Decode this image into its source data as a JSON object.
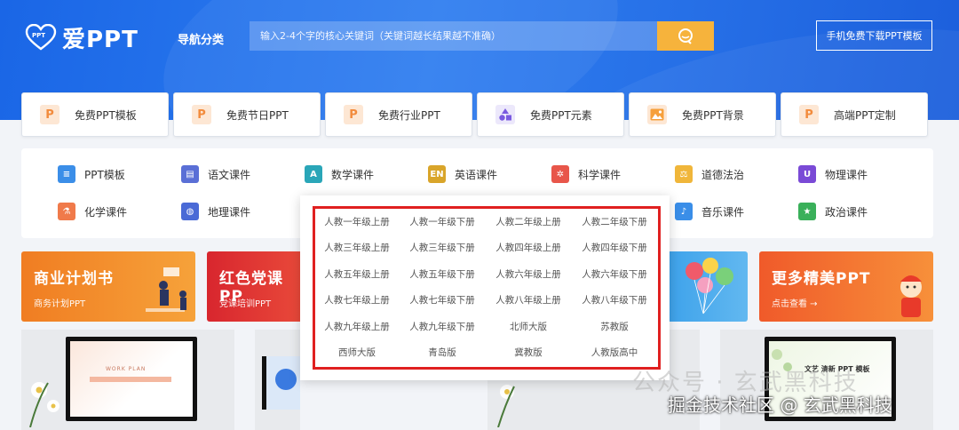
{
  "header": {
    "logo_text": "爱PPT",
    "logo_small": "PPT",
    "nav_category": "导航分类",
    "search_placeholder": "输入2-4个字的核心关键词（关键词越长结果越不准确）",
    "mobile_button": "手机免费下载PPT模板"
  },
  "categories": [
    {
      "label": "免费PPT模板",
      "icon": "P"
    },
    {
      "label": "免费节日PPT",
      "icon": "P"
    },
    {
      "label": "免费行业PPT",
      "icon": "P"
    },
    {
      "label": "免费PPT元素",
      "icon": "shapes"
    },
    {
      "label": "免费PPT背景",
      "icon": "image"
    },
    {
      "label": "高端PPT定制",
      "icon": "P"
    }
  ],
  "subjects": [
    {
      "label": "PPT模板",
      "color": "#3b8ee8"
    },
    {
      "label": "语文课件",
      "color": "#5a6fd6"
    },
    {
      "label": "数学课件",
      "color": "#2aa6b8"
    },
    {
      "label": "英语课件",
      "color": "#d9a52a"
    },
    {
      "label": "科学课件",
      "color": "#e8564a"
    },
    {
      "label": "道德法治",
      "color": "#f0b63a"
    },
    {
      "label": "物理课件",
      "color": "#7a4ad6"
    },
    {
      "label": "化学课件",
      "color": "#f07a4a"
    },
    {
      "label": "地理课件",
      "color": "#4a6ad6"
    },
    {
      "label": "音乐课件",
      "color": "#3a8ee8"
    },
    {
      "label": "政治课件",
      "color": "#3ab05a"
    }
  ],
  "dropdown": [
    [
      "人教一年级上册",
      "人教一年级下册",
      "人教二年级上册",
      "人教二年级下册"
    ],
    [
      "人教三年级上册",
      "人教三年级下册",
      "人教四年级上册",
      "人教四年级下册"
    ],
    [
      "人教五年级上册",
      "人教五年级下册",
      "人教六年级上册",
      "人教六年级下册"
    ],
    [
      "人教七年级上册",
      "人教七年级下册",
      "人教八年级上册",
      "人教八年级下册"
    ],
    [
      "人教九年级上册",
      "人教九年级下册",
      "北师大版",
      "苏教版"
    ],
    [
      "西师大版",
      "青岛版",
      "冀教版",
      "人教版高中"
    ]
  ],
  "banners": {
    "business": {
      "title": "商业计划书",
      "subtitle": "商务计划PPT"
    },
    "party": {
      "title": "红色党课PP",
      "subtitle": "党课培训PPT"
    },
    "more": {
      "title": "更多精美PPT",
      "subtitle": "点击查看 →"
    }
  },
  "template_card_text": {
    "work_plan": "WORK PLAN",
    "card4_title": "文艺 清新 PPT 模板"
  },
  "watermark": {
    "line1": "公众号 · 玄武黑科技",
    "line2": "掘金技术社区 @ 玄武黑科技"
  },
  "colors": {
    "brand_blue": "#1a66e6",
    "search_button": "#f6b33c",
    "highlight_red": "#e02020"
  }
}
